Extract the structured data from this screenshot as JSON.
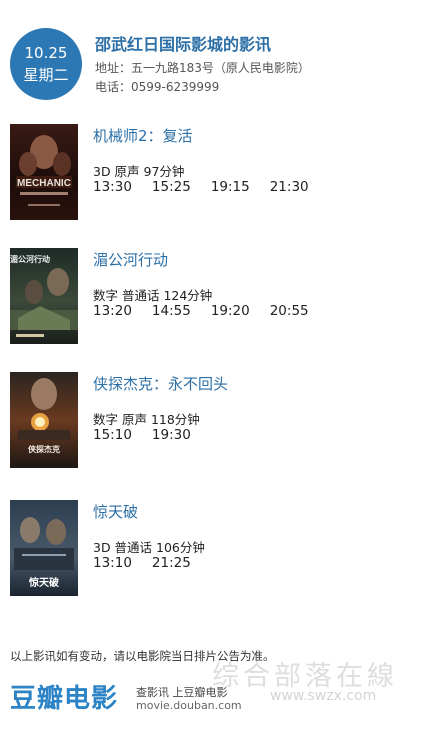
{
  "header": {
    "date": "10.25",
    "weekday": "星期二",
    "cinema_name": "邵武红日国际影城的影讯",
    "address": "地址：五一九路183号（原人民电影院）",
    "phone": "电话：0599-6239999"
  },
  "movies": [
    {
      "title": "机械师2：复活",
      "format": "3D  原声  97分钟",
      "times": [
        "13:30",
        "15:25",
        "19:15",
        "21:30"
      ],
      "poster_text": "MECHANIC"
    },
    {
      "title": "湄公河行动",
      "format": "数字  普通话  124分钟",
      "times": [
        "13:20",
        "14:55",
        "19:20",
        "20:55"
      ],
      "poster_text": "湄公河行动"
    },
    {
      "title": "侠探杰克：永不回头",
      "format": "数字  原声  118分钟",
      "times": [
        "15:10",
        "19:30"
      ],
      "poster_text": "侠探杰克"
    },
    {
      "title": "惊天破",
      "format": "3D  普通话  106分钟",
      "times": [
        "13:10",
        "21:25"
      ],
      "poster_text": "惊天破"
    }
  ],
  "footer": {
    "notice": "以上影讯如有变动，请以电影院当日排片公告为准。",
    "logo": "豆瓣电影",
    "slogan": "查影讯 上豆瓣电影",
    "site": "movie.douban.com",
    "watermark_cn": "综合部落在線",
    "watermark_en": "www.swzx.com"
  }
}
